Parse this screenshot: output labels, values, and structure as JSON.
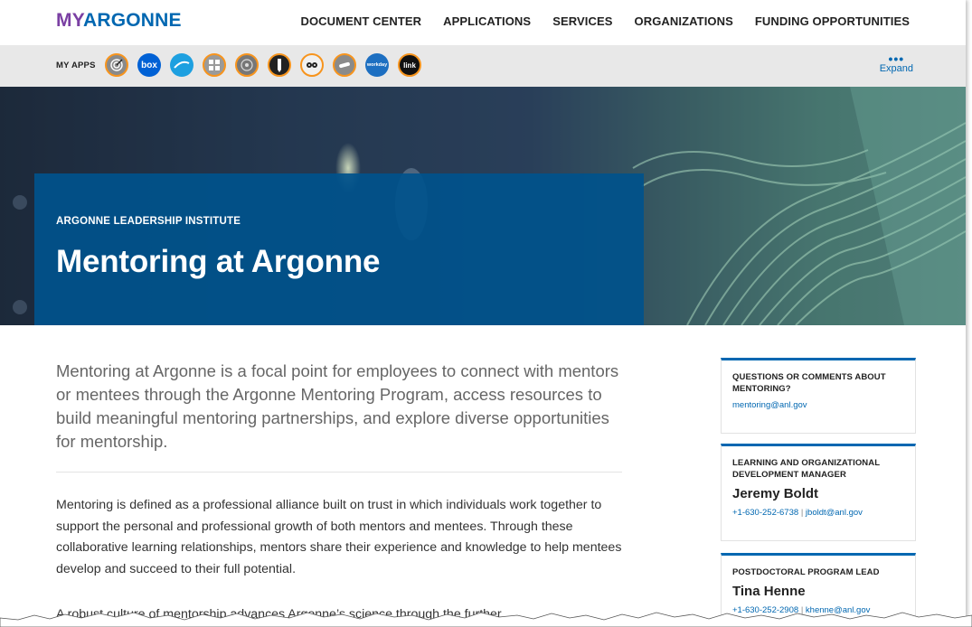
{
  "logo": {
    "part1": "MY",
    "part2": "ARGONNE"
  },
  "nav": [
    "DOCUMENT CENTER",
    "APPLICATIONS",
    "SERVICES",
    "ORGANIZATIONS",
    "FUNDING OPPORTUNITIES"
  ],
  "apps": {
    "label": "MY APPS",
    "icons": [
      "target-app-icon",
      "box-app-icon",
      "cloud-app-icon",
      "calculator-app-icon",
      "grid-app-icon",
      "pen-app-icon",
      "panda-app-icon",
      "telescope-app-icon",
      "workday-app-icon",
      "link-app-icon"
    ],
    "box_text": "box",
    "workday_text": "workday",
    "link_text": "link",
    "expand_dots": "•••",
    "expand_label": "Expand"
  },
  "hero": {
    "eyebrow": "ARGONNE LEADERSHIP INSTITUTE",
    "title": "Mentoring at Argonne"
  },
  "main": {
    "lead": "Mentoring at Argonne is a focal point for employees to connect with mentors or mentees through the Argonne Mentoring Program, access resources to build meaningful mentoring partnerships, and explore diverse opportunities for mentorship.",
    "para1": "Mentoring is defined as a professional alliance built on trust in which individuals work together to support the personal and professional growth of both mentors and mentees. Through these collaborative learning relationships, mentors share their experience and knowledge to help mentees develop and succeed to their full potential.",
    "para2": "A robust culture of mentorship advances Argonne’s science through the further"
  },
  "sidebar": {
    "cards": [
      {
        "heading": "QUESTIONS OR COMMENTS ABOUT MENTORING?",
        "email": "mentoring@anl.gov"
      },
      {
        "heading": "LEARNING AND ORGANIZATIONAL DEVELOPMENT MANAGER",
        "name": "Jeremy Boldt",
        "phone": "+1-630-252-6738",
        "sep": "|",
        "email": "jboldt@anl.gov"
      },
      {
        "heading": "POSTDOCTORAL PROGRAM LEAD",
        "name": "Tina Henne",
        "phone": "+1-630-252-2908",
        "sep": "|",
        "email": "khenne@anl.gov"
      }
    ]
  },
  "colors": {
    "accent": "#0067b1",
    "purple": "#7a3fa3",
    "hero_band": "#00528c",
    "app_ring": "#f7941d"
  }
}
